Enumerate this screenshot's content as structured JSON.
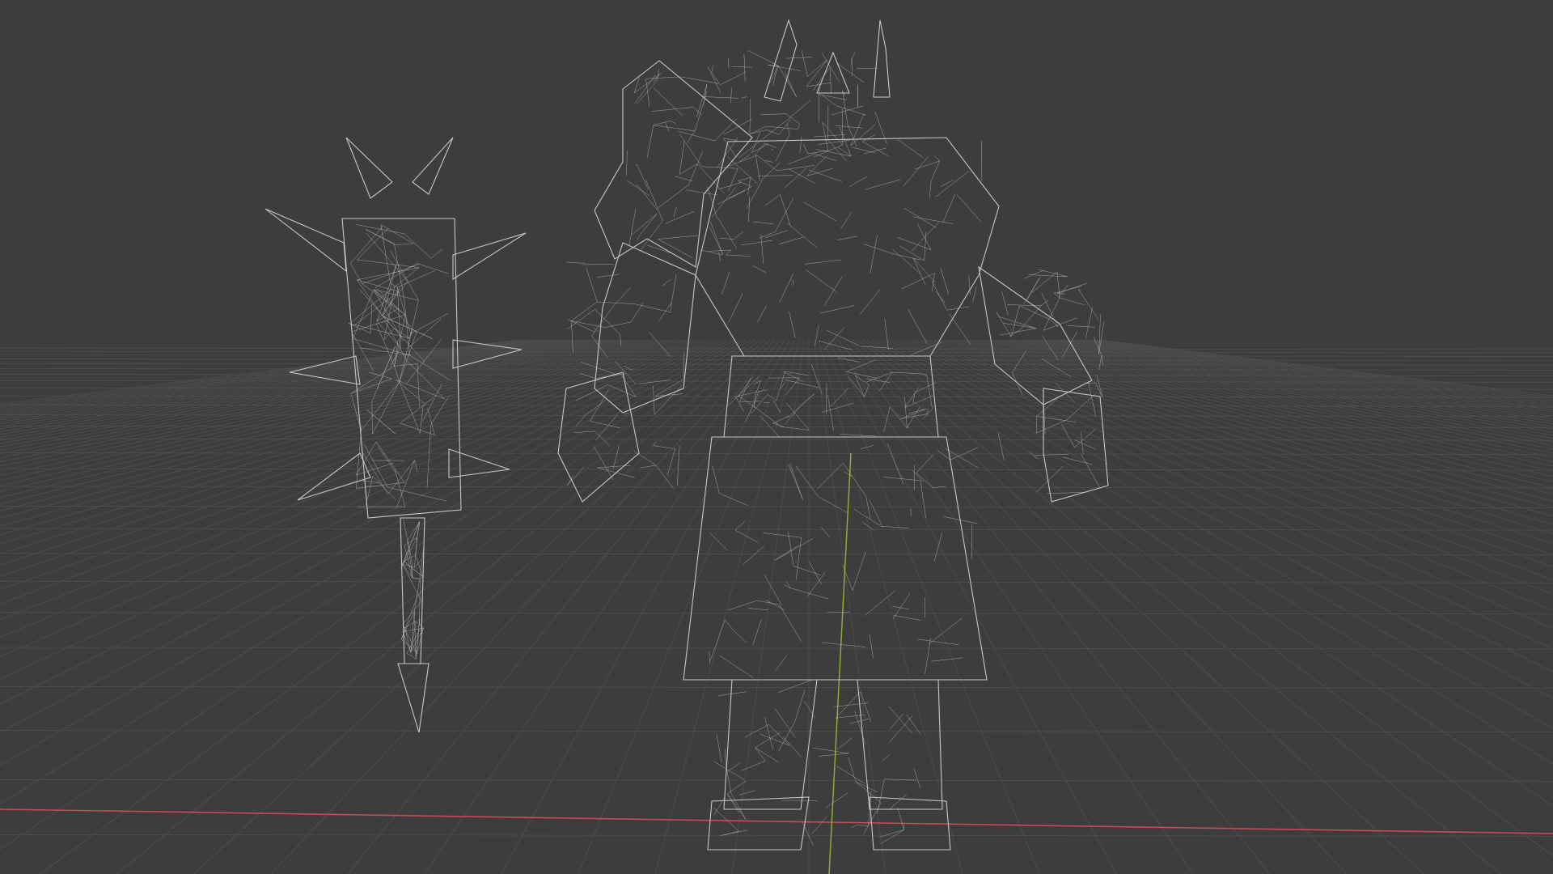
{
  "viewport": {
    "mode": "wireframe",
    "background_color": "#3d3d3d",
    "grid_color": "#4f4f4f",
    "x_axis_color": "#c94b5a",
    "y_axis_color": "#8fb534",
    "wire_color": "#c7c7c7"
  },
  "objects": [
    {
      "name": "spiked-mace",
      "type": "mesh"
    },
    {
      "name": "horned-warrior",
      "type": "mesh"
    }
  ]
}
